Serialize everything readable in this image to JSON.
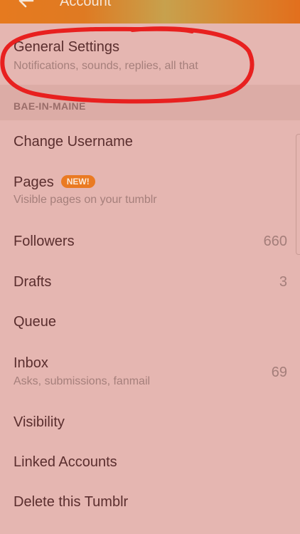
{
  "header": {
    "title": "Account",
    "back_icon": "arrow-left-icon"
  },
  "general_settings": {
    "title": "General Settings",
    "subtitle": "Notifications, sounds, replies, all that"
  },
  "section": {
    "label": "BAE-IN-MAINE"
  },
  "items": {
    "change_username": {
      "title": "Change Username"
    },
    "pages": {
      "title": "Pages",
      "badge": "NEW!",
      "subtitle": "Visible pages on your tumblr"
    },
    "followers": {
      "title": "Followers",
      "count": "660"
    },
    "drafts": {
      "title": "Drafts",
      "count": "3"
    },
    "queue": {
      "title": "Queue"
    },
    "inbox": {
      "title": "Inbox",
      "subtitle": "Asks, submissions, fanmail",
      "count": "69"
    },
    "visibility": {
      "title": "Visibility"
    },
    "linked_accounts": {
      "title": "Linked Accounts"
    },
    "delete_tumblr": {
      "title": "Delete this Tumblr"
    }
  },
  "colors": {
    "background": "#e5b6b1",
    "header": "#e67a1f",
    "badge": "#ea7a22",
    "annotation_circle": "#e8201f"
  }
}
